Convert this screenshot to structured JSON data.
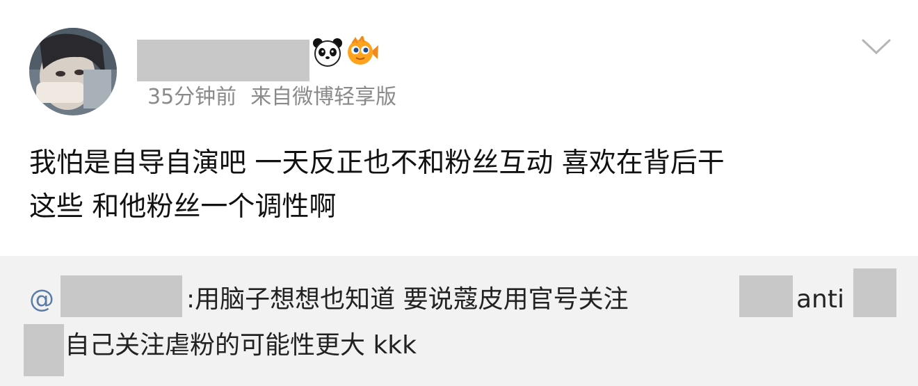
{
  "post": {
    "timestamp": "35分钟前",
    "source": "来自微博轻享版",
    "content": "我怕是自导自演吧 一天反正也不和粉丝互动 喜欢在背后干\n这些 和他粉丝一个调性啊",
    "badges": [
      "panda-icon",
      "fish-icon"
    ],
    "menu_icon": "chevron-down-icon"
  },
  "repost": {
    "at_sign": "@",
    "text_part1": ":用脑子想想也知道 要说蔻皮用官号关注",
    "text_part2": "anti",
    "text_part3": "自己关注虐粉的可能性更大 kkk"
  },
  "colors": {
    "repost_background": "#f2f2f2",
    "mention": "#5a7ca8",
    "meta": "#8a8a8a",
    "redaction": "#c8c8c8"
  }
}
